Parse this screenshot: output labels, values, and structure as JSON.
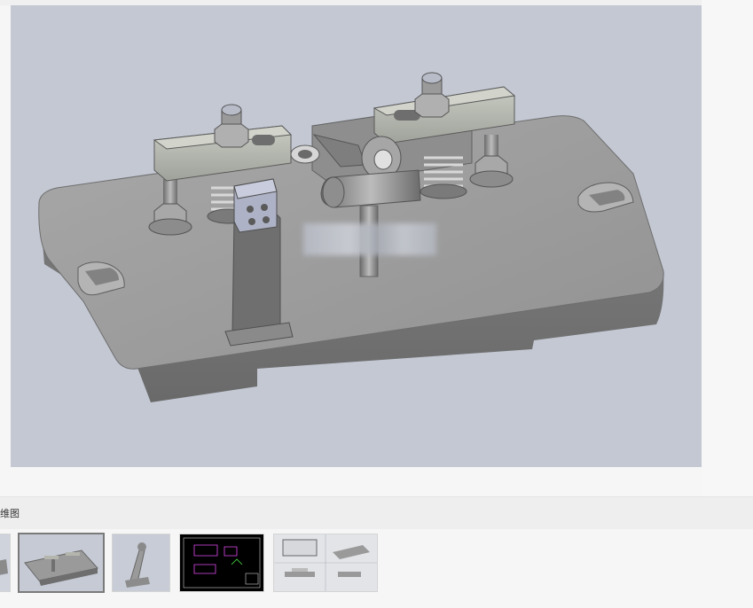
{
  "label_bar": {
    "text": "维图"
  },
  "thumbnails": [
    {
      "name": "partial-view-thumbnail",
      "icon": "model-partial"
    },
    {
      "name": "fixture-iso-thumbnail",
      "icon": "fixture-iso",
      "active": true
    },
    {
      "name": "clamp-part-thumbnail",
      "icon": "clamp-part"
    },
    {
      "name": "cad-drawing-thumbnail",
      "icon": "cad-drawing-dark"
    },
    {
      "name": "three-view-thumbnail",
      "icon": "orthographic-views"
    }
  ],
  "colors": {
    "viewport_bg": "#c3c8d3",
    "part_gray": "#9a9a9a",
    "page_bg": "#f6f6f6",
    "cad_bg": "#000000"
  }
}
